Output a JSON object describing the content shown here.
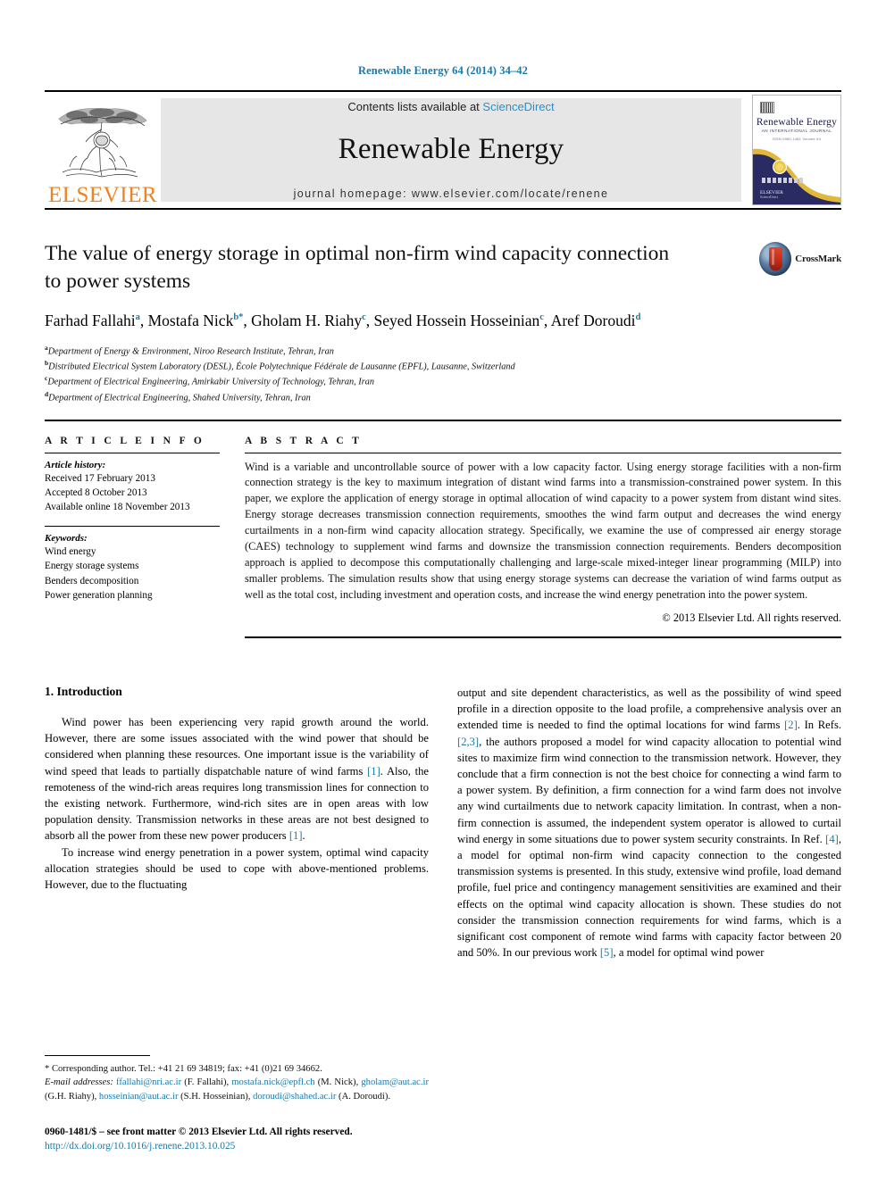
{
  "running_head": "Renewable Energy 64 (2014) 34–42",
  "masthead": {
    "publisher": "ELSEVIER",
    "contents_prefix": "Contents lists available at",
    "contents_link": "ScienceDirect",
    "journal_name": "Renewable Energy",
    "homepage": "journal homepage: www.elsevier.com/locate/renene",
    "cover": {
      "title": "Renewable Energy",
      "subtitle": "AN INTERNATIONAL JOURNAL",
      "subtitle2": "ISSN 0960-1481  Volume 64",
      "foot": "ELSEVIER",
      "foot_small": "ScienceDirect"
    }
  },
  "article": {
    "title": "The value of energy storage in optimal non-firm wind capacity connection to power systems",
    "crossmark_label": "CrossMark",
    "authors": [
      {
        "name": "Farhad Fallahi",
        "sup": "a",
        "star": false
      },
      {
        "name": "Mostafa Nick",
        "sup": "b",
        "star": true
      },
      {
        "name": "Gholam H. Riahy",
        "sup": "c",
        "star": false
      },
      {
        "name": "Seyed Hossein Hosseinian",
        "sup": "c",
        "star": false
      },
      {
        "name": "Aref Doroudi",
        "sup": "d",
        "star": false
      }
    ],
    "affiliations": [
      {
        "mark": "a",
        "text": "Department of Energy & Environment, Niroo Research Institute, Tehran, Iran"
      },
      {
        "mark": "b",
        "text": "Distributed Electrical System Laboratory (DESL), École Polytechnique Fédérale de Lausanne (EPFL), Lausanne, Switzerland"
      },
      {
        "mark": "c",
        "text": "Department of Electrical Engineering, Amirkabir University of Technology, Tehran, Iran"
      },
      {
        "mark": "d",
        "text": "Department of Electrical Engineering, Shahed University, Tehran, Iran"
      }
    ]
  },
  "info": {
    "heading": "A R T I C L E   I N F O",
    "history_label": "Article history:",
    "history": [
      "Received 17 February 2013",
      "Accepted 8 October 2013",
      "Available online 18 November 2013"
    ],
    "keywords_label": "Keywords:",
    "keywords": [
      "Wind energy",
      "Energy storage systems",
      "Benders decomposition",
      "Power generation planning"
    ]
  },
  "abstract": {
    "heading": "A B S T R A C T",
    "text": "Wind is a variable and uncontrollable source of power with a low capacity factor. Using energy storage facilities with a non-firm connection strategy is the key to maximum integration of distant wind farms into a transmission-constrained power system. In this paper, we explore the application of energy storage in optimal allocation of wind capacity to a power system from distant wind sites. Energy storage decreases transmission connection requirements, smoothes the wind farm output and decreases the wind energy curtailments in a non-firm wind capacity allocation strategy. Specifically, we examine the use of compressed air energy storage (CAES) technology to supplement wind farms and downsize the transmission connection requirements. Benders decomposition approach is applied to decompose this computationally challenging and large-scale mixed-integer linear programming (MILP) into smaller problems. The simulation results show that using energy storage systems can decrease the variation of wind farms output as well as the total cost, including investment and operation costs, and increase the wind energy penetration into the power system.",
    "copyright": "© 2013 Elsevier Ltd. All rights reserved."
  },
  "body": {
    "section_heading": "1.  Introduction",
    "left_paragraph_1_a": "Wind power has been experiencing very rapid growth around the world. However, there are some issues associated with the wind power that should be considered when planning these resources. One important issue is the variability of wind speed that leads to partially dispatchable nature of wind farms ",
    "ref1": "[1]",
    "left_paragraph_1_b": ". Also, the remoteness of the wind-rich areas requires long transmission lines for connection to the existing network. Furthermore, wind-rich sites are in open areas with low population density. Transmission networks in these areas are not best designed to absorb all the power from these new power producers ",
    "ref1b": "[1]",
    "left_paragraph_1_c": ".",
    "left_paragraph_2": "To increase wind energy penetration in a power system, optimal wind capacity allocation strategies should be used to cope with above-mentioned problems. However, due to the fluctuating",
    "right_paragraph_a": "output and site dependent characteristics, as well as the possibility of wind speed profile in a direction opposite to the load profile, a comprehensive analysis over an extended time is needed to find the optimal locations for wind farms ",
    "ref2": "[2]",
    "right_paragraph_b": ". In Refs. ",
    "ref23": "[2,3]",
    "right_paragraph_c": ", the authors proposed a model for wind capacity allocation to potential wind sites to maximize firm wind connection to the transmission network. However, they conclude that a firm connection is not the best choice for connecting a wind farm to a power system. By definition, a firm connection for a wind farm does not involve any wind curtailments due to network capacity limitation. In contrast, when a non-firm connection is assumed, the independent system operator is allowed to curtail wind energy in some situations due to power system security constraints. In Ref. ",
    "ref4": "[4]",
    "right_paragraph_d": ", a model for optimal non-firm wind capacity connection to the congested transmission systems is presented. In this study, extensive wind profile, load demand profile, fuel price and contingency management sensitivities are examined and their effects on the optimal wind capacity allocation is shown. These studies do not consider the transmission connection requirements for wind farms, which is a significant cost component of remote wind farms with capacity factor between 20 and 50%. In our previous work ",
    "ref5": "[5]",
    "right_paragraph_e": ", a model for optimal wind power"
  },
  "footnotes": {
    "corresponding": "* Corresponding author. Tel.: +41 21 69 34819; fax: +41 (0)21 69 34662.",
    "email_label": "E-mail addresses:",
    "emails": [
      {
        "address": "ffallahi@nri.ac.ir",
        "person": "(F. Fallahi)"
      },
      {
        "address": "mostafa.nick@epfl.ch",
        "person": "(M. Nick)"
      },
      {
        "address": "gholam@aut.ac.ir",
        "person": "(G.H. Riahy)"
      },
      {
        "address": "hosseinian@aut.ac.ir",
        "person": "(S.H. Hosseinian)"
      },
      {
        "address": "doroudi@shahed.ac.ir",
        "person": "(A. Doroudi)"
      }
    ],
    "issn": "0960-1481/$ – see front matter © 2013 Elsevier Ltd. All rights reserved.",
    "doi": "http://dx.doi.org/10.1016/j.renene.2013.10.025"
  },
  "colors": {
    "link": "#1b78a8",
    "elsevier_orange": "#f08221",
    "sciencedirect": "#2d8fc4"
  }
}
